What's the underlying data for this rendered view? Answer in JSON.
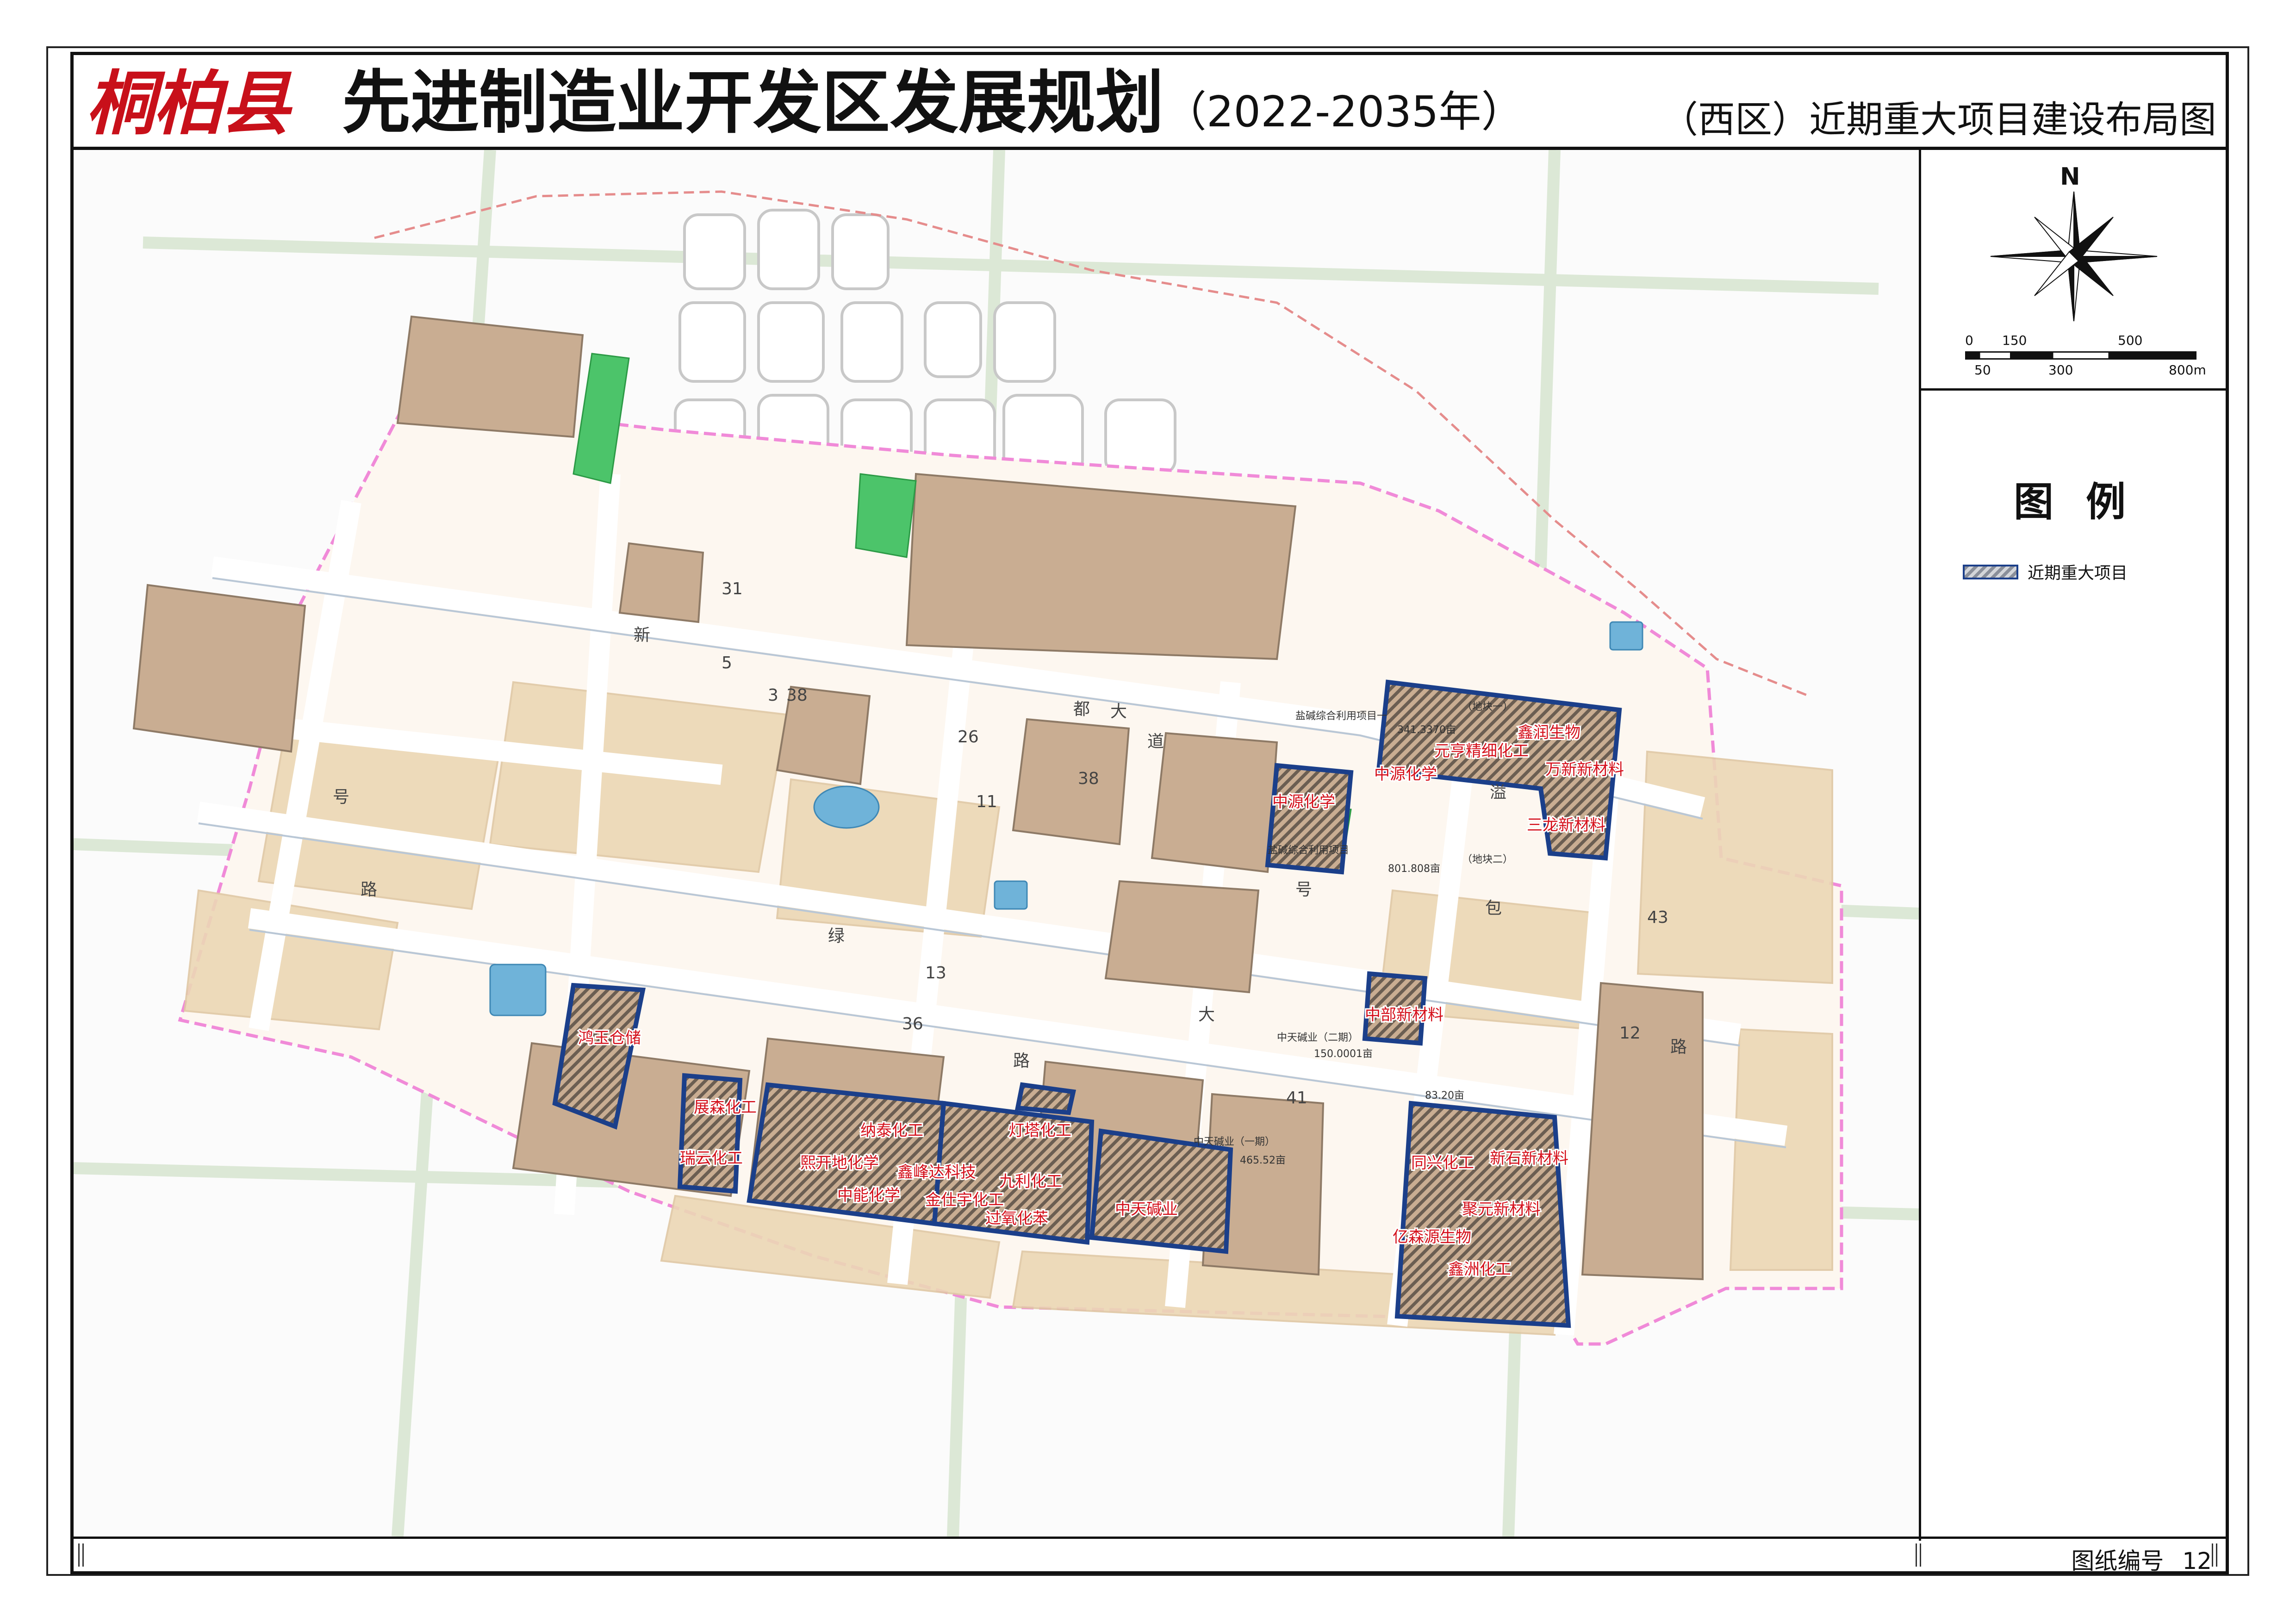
{
  "header": {
    "logo_text": "桐柏县",
    "title": "先进制造业开发区发展规划",
    "title_years": "（2022-2035年）",
    "subtitle": "（西区）近期重大项目建设布局图"
  },
  "compass": {
    "north_label": "N"
  },
  "scale_bar": {
    "top_labels": [
      "0",
      "150",
      "500"
    ],
    "bottom_labels": [
      "50",
      "300",
      "800m"
    ]
  },
  "legend": {
    "title": "图例",
    "items": [
      {
        "label": "近期重大项目",
        "swatch_color": "#1b3f8a"
      }
    ]
  },
  "footer": {
    "sheet_label": "图纸编号",
    "sheet_number": "12"
  },
  "map": {
    "project_labels": [
      "鸿玉仓储",
      "展森化工",
      "瑞云化工",
      "熙开地化学",
      "纳泰化工",
      "中能化学",
      "鑫峰达科技",
      "金仕宇化工",
      "灯塔化工",
      "九利化工",
      "过氧化苯",
      "中天碱业",
      "中部新材料",
      "中源化学",
      "中源化学",
      "元亨精细化工",
      "鑫润生物",
      "万新新材料",
      "三龙新材料",
      "同兴化工",
      "新石新材料",
      "聚元新材料",
      "亿森源生物",
      "鑫洲化工"
    ],
    "parcel_labels": [
      "盐碱综合利用项目一",
      "盐碱综合利用项目",
      "中天碱业（二期）",
      "150.0001亩",
      "中天碱业（一期）",
      "465.52亩",
      "801.808亩",
      "83.20亩",
      "341.3370亩",
      "（地块一）",
      "（地块二）"
    ],
    "road_numbers": [
      "38",
      "38",
      "11",
      "12",
      "13",
      "41",
      "43",
      "31",
      "3",
      "5",
      "26",
      "36"
    ],
    "road_chars": [
      "新",
      "都",
      "大",
      "道",
      "号",
      "路",
      "绿",
      "溢",
      "包",
      "号",
      "路",
      "大",
      "路"
    ],
    "colors": {
      "project_outline": "#1b3f8a",
      "industrial": "#c9ad92",
      "development": "#ecd7b5",
      "green": "#4cc46a",
      "water": "#6fb3d9",
      "boundary": "#f08ad8",
      "label_red": "#d40f1a"
    }
  }
}
